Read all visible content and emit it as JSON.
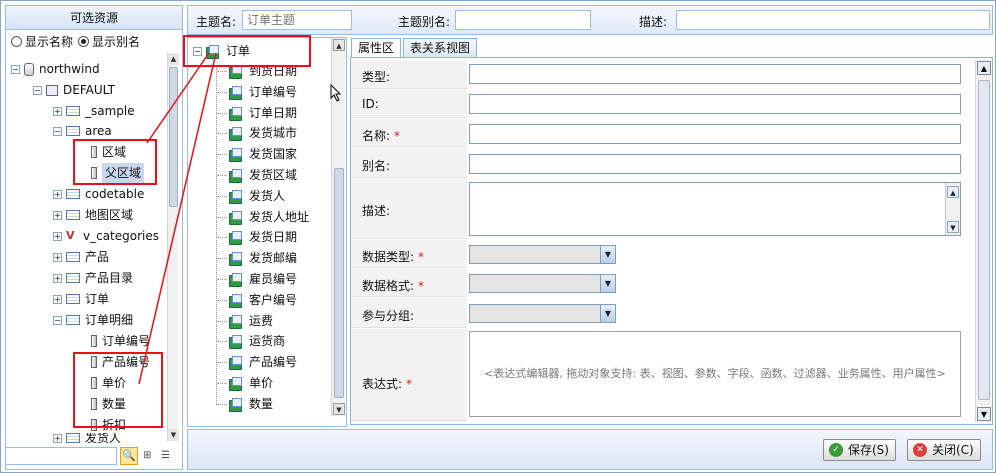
{
  "left_panel": {
    "title": "可选资源",
    "radio_show_name": "显示名称",
    "radio_show_alias": "显示别名",
    "tree": {
      "database": "northwind",
      "schema": "DEFAULT",
      "sample_table": "_sample",
      "area_table": "area",
      "area_col_1": "区域",
      "area_col_2": "父区域",
      "codetable": "codetable",
      "geo_table": "地图区域",
      "view_categories": "v_categories",
      "product": "产品",
      "product_catalog": "产品目录",
      "orders": "订单",
      "order_details": "订单明细",
      "od_col_1": "订单编号",
      "od_col_2": "产品编号",
      "od_col_3": "单价",
      "od_col_4": "数量",
      "od_col_5": "折扣",
      "shipper_partial": "发货人"
    },
    "search_value": ""
  },
  "topbar": {
    "subject_name_label": "主题名:",
    "subject_name_placeholder": "订单主题",
    "subject_alias_label": "主题别名:",
    "desc_label": "描述:"
  },
  "subject_tree": {
    "root": "订单",
    "fields": [
      "到货日期",
      "订单编号",
      "订单日期",
      "发货城市",
      "发货国家",
      "发货区域",
      "发货人",
      "发货人地址",
      "发货日期",
      "发货邮编",
      "雇员编号",
      "客户编号",
      "运费",
      "运货商",
      "产品编号",
      "单价",
      "数量"
    ]
  },
  "tabs": {
    "attributes": "属性区",
    "relation_view": "表关系视图"
  },
  "form": {
    "type_label": "类型:",
    "id_label": "ID:",
    "name_label": "名称:",
    "alias_label": "别名:",
    "desc_label": "描述:",
    "data_type_label": "数据类型:",
    "data_format_label": "数据格式:",
    "group_label": "参与分组:",
    "expression_label": "表达式:",
    "required_mark": "*",
    "expression_hint": "<表达式编辑器, 拖动对象支持: 表、视图、参数、字段、函数、过滤器、业务属性、用户属性>"
  },
  "buttons": {
    "save": "保存(S)",
    "close": "关闭(C)"
  },
  "colors": {
    "panel_border": "#99bbe8",
    "annotation_red": "#e8101a",
    "required_red": "#d42020",
    "field_icon_green": "#2d9a4e"
  }
}
